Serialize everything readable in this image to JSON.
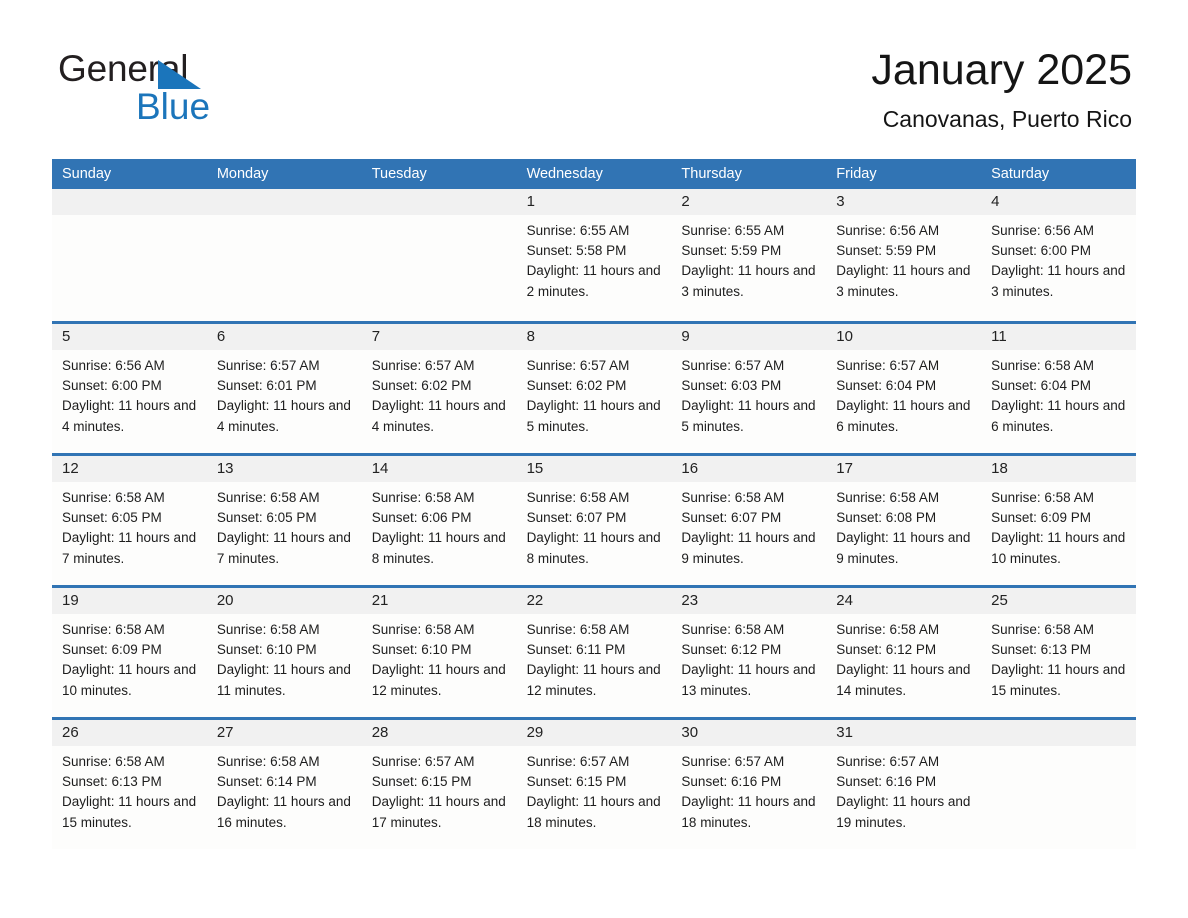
{
  "brand": {
    "name_top": "General",
    "name_bottom": "Blue",
    "accent_color": "#1b75bb",
    "triangle_icon": "brand-triangle-icon"
  },
  "header": {
    "month_title": "January 2025",
    "location": "Canovanas, Puerto Rico"
  },
  "theme": {
    "header_blue": "#3174b4",
    "daynum_band": "#f1f1f1",
    "cell_background": "#fdfdfc",
    "text_color": "#1d1d1d"
  },
  "weekdays": [
    "Sunday",
    "Monday",
    "Tuesday",
    "Wednesday",
    "Thursday",
    "Friday",
    "Saturday"
  ],
  "weeks": [
    [
      {
        "day": "",
        "sunrise": "",
        "sunset": "",
        "daylight": "",
        "empty": true
      },
      {
        "day": "",
        "sunrise": "",
        "sunset": "",
        "daylight": "",
        "empty": true
      },
      {
        "day": "",
        "sunrise": "",
        "sunset": "",
        "daylight": "",
        "empty": true
      },
      {
        "day": "1",
        "sunrise": "Sunrise: 6:55 AM",
        "sunset": "Sunset: 5:58 PM",
        "daylight": "Daylight: 11 hours and 2 minutes."
      },
      {
        "day": "2",
        "sunrise": "Sunrise: 6:55 AM",
        "sunset": "Sunset: 5:59 PM",
        "daylight": "Daylight: 11 hours and 3 minutes."
      },
      {
        "day": "3",
        "sunrise": "Sunrise: 6:56 AM",
        "sunset": "Sunset: 5:59 PM",
        "daylight": "Daylight: 11 hours and 3 minutes."
      },
      {
        "day": "4",
        "sunrise": "Sunrise: 6:56 AM",
        "sunset": "Sunset: 6:00 PM",
        "daylight": "Daylight: 11 hours and 3 minutes."
      }
    ],
    [
      {
        "day": "5",
        "sunrise": "Sunrise: 6:56 AM",
        "sunset": "Sunset: 6:00 PM",
        "daylight": "Daylight: 11 hours and 4 minutes."
      },
      {
        "day": "6",
        "sunrise": "Sunrise: 6:57 AM",
        "sunset": "Sunset: 6:01 PM",
        "daylight": "Daylight: 11 hours and 4 minutes."
      },
      {
        "day": "7",
        "sunrise": "Sunrise: 6:57 AM",
        "sunset": "Sunset: 6:02 PM",
        "daylight": "Daylight: 11 hours and 4 minutes."
      },
      {
        "day": "8",
        "sunrise": "Sunrise: 6:57 AM",
        "sunset": "Sunset: 6:02 PM",
        "daylight": "Daylight: 11 hours and 5 minutes."
      },
      {
        "day": "9",
        "sunrise": "Sunrise: 6:57 AM",
        "sunset": "Sunset: 6:03 PM",
        "daylight": "Daylight: 11 hours and 5 minutes."
      },
      {
        "day": "10",
        "sunrise": "Sunrise: 6:57 AM",
        "sunset": "Sunset: 6:04 PM",
        "daylight": "Daylight: 11 hours and 6 minutes."
      },
      {
        "day": "11",
        "sunrise": "Sunrise: 6:58 AM",
        "sunset": "Sunset: 6:04 PM",
        "daylight": "Daylight: 11 hours and 6 minutes."
      }
    ],
    [
      {
        "day": "12",
        "sunrise": "Sunrise: 6:58 AM",
        "sunset": "Sunset: 6:05 PM",
        "daylight": "Daylight: 11 hours and 7 minutes."
      },
      {
        "day": "13",
        "sunrise": "Sunrise: 6:58 AM",
        "sunset": "Sunset: 6:05 PM",
        "daylight": "Daylight: 11 hours and 7 minutes."
      },
      {
        "day": "14",
        "sunrise": "Sunrise: 6:58 AM",
        "sunset": "Sunset: 6:06 PM",
        "daylight": "Daylight: 11 hours and 8 minutes."
      },
      {
        "day": "15",
        "sunrise": "Sunrise: 6:58 AM",
        "sunset": "Sunset: 6:07 PM",
        "daylight": "Daylight: 11 hours and 8 minutes."
      },
      {
        "day": "16",
        "sunrise": "Sunrise: 6:58 AM",
        "sunset": "Sunset: 6:07 PM",
        "daylight": "Daylight: 11 hours and 9 minutes."
      },
      {
        "day": "17",
        "sunrise": "Sunrise: 6:58 AM",
        "sunset": "Sunset: 6:08 PM",
        "daylight": "Daylight: 11 hours and 9 minutes."
      },
      {
        "day": "18",
        "sunrise": "Sunrise: 6:58 AM",
        "sunset": "Sunset: 6:09 PM",
        "daylight": "Daylight: 11 hours and 10 minutes."
      }
    ],
    [
      {
        "day": "19",
        "sunrise": "Sunrise: 6:58 AM",
        "sunset": "Sunset: 6:09 PM",
        "daylight": "Daylight: 11 hours and 10 minutes."
      },
      {
        "day": "20",
        "sunrise": "Sunrise: 6:58 AM",
        "sunset": "Sunset: 6:10 PM",
        "daylight": "Daylight: 11 hours and 11 minutes."
      },
      {
        "day": "21",
        "sunrise": "Sunrise: 6:58 AM",
        "sunset": "Sunset: 6:10 PM",
        "daylight": "Daylight: 11 hours and 12 minutes."
      },
      {
        "day": "22",
        "sunrise": "Sunrise: 6:58 AM",
        "sunset": "Sunset: 6:11 PM",
        "daylight": "Daylight: 11 hours and 12 minutes."
      },
      {
        "day": "23",
        "sunrise": "Sunrise: 6:58 AM",
        "sunset": "Sunset: 6:12 PM",
        "daylight": "Daylight: 11 hours and 13 minutes."
      },
      {
        "day": "24",
        "sunrise": "Sunrise: 6:58 AM",
        "sunset": "Sunset: 6:12 PM",
        "daylight": "Daylight: 11 hours and 14 minutes."
      },
      {
        "day": "25",
        "sunrise": "Sunrise: 6:58 AM",
        "sunset": "Sunset: 6:13 PM",
        "daylight": "Daylight: 11 hours and 15 minutes."
      }
    ],
    [
      {
        "day": "26",
        "sunrise": "Sunrise: 6:58 AM",
        "sunset": "Sunset: 6:13 PM",
        "daylight": "Daylight: 11 hours and 15 minutes."
      },
      {
        "day": "27",
        "sunrise": "Sunrise: 6:58 AM",
        "sunset": "Sunset: 6:14 PM",
        "daylight": "Daylight: 11 hours and 16 minutes."
      },
      {
        "day": "28",
        "sunrise": "Sunrise: 6:57 AM",
        "sunset": "Sunset: 6:15 PM",
        "daylight": "Daylight: 11 hours and 17 minutes."
      },
      {
        "day": "29",
        "sunrise": "Sunrise: 6:57 AM",
        "sunset": "Sunset: 6:15 PM",
        "daylight": "Daylight: 11 hours and 18 minutes."
      },
      {
        "day": "30",
        "sunrise": "Sunrise: 6:57 AM",
        "sunset": "Sunset: 6:16 PM",
        "daylight": "Daylight: 11 hours and 18 minutes."
      },
      {
        "day": "31",
        "sunrise": "Sunrise: 6:57 AM",
        "sunset": "Sunset: 6:16 PM",
        "daylight": "Daylight: 11 hours and 19 minutes."
      },
      {
        "day": "",
        "sunrise": "",
        "sunset": "",
        "daylight": "",
        "empty": true
      }
    ]
  ]
}
